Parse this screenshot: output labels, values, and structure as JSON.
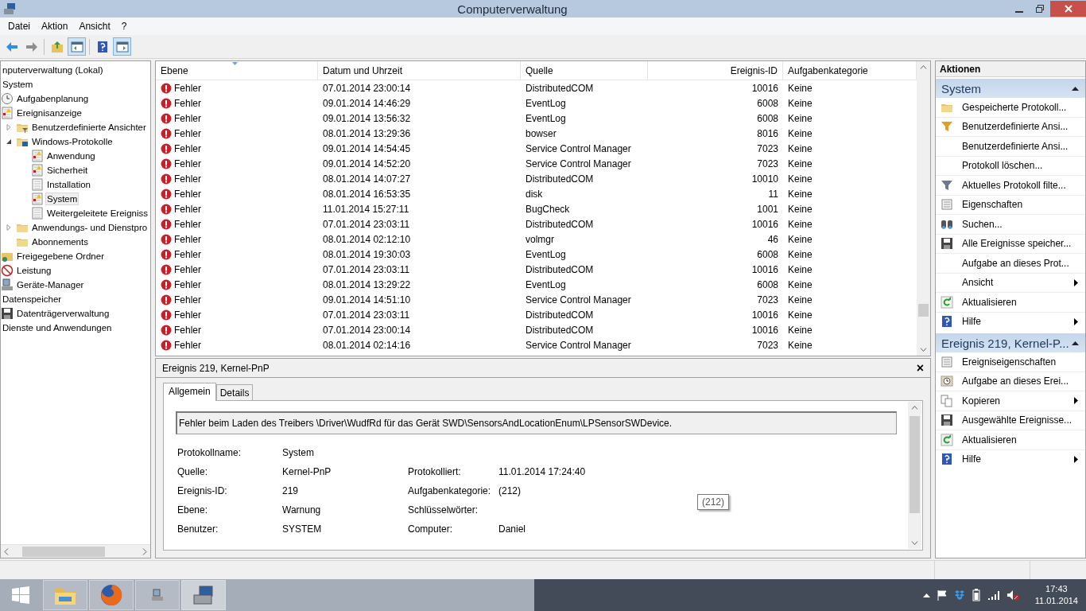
{
  "window": {
    "title": "Computerverwaltung"
  },
  "menu": [
    "Datei",
    "Aktion",
    "Ansicht",
    "?"
  ],
  "toolbar": [
    {
      "kind": "back",
      "pressed": false
    },
    {
      "kind": "forward",
      "pressed": false
    },
    {
      "kind": "sep"
    },
    {
      "kind": "up",
      "pressed": false
    },
    {
      "kind": "tree",
      "pressed": true
    },
    {
      "kind": "sep"
    },
    {
      "kind": "help",
      "pressed": false
    },
    {
      "kind": "pane",
      "pressed": true
    }
  ],
  "tree": [
    {
      "label": "nputerverwaltung (Lokal)",
      "selected": false,
      "children": [
        {
          "label": "System",
          "selected": false,
          "children": [
            {
              "label": "Aufgabenplanung",
              "kind": "clock",
              "selected": false
            },
            {
              "label": "Ereignisanzeige",
              "kind": "viewer",
              "selected": false,
              "children": [
                {
                  "label": "Benutzerdefinierte Ansichter",
                  "kind": "filterfolder",
                  "expanded": false,
                  "selected": false
                },
                {
                  "label": "Windows-Protokolle",
                  "kind": "pcfolder",
                  "expanded": true,
                  "selected": false,
                  "children": [
                    {
                      "label": "Anwendung",
                      "kind": "log",
                      "selected": false
                    },
                    {
                      "label": "Sicherheit",
                      "kind": "log",
                      "selected": false
                    },
                    {
                      "label": "Installation",
                      "kind": "plainlog",
                      "selected": false
                    },
                    {
                      "label": "System",
                      "kind": "log",
                      "selected": true
                    },
                    {
                      "label": "Weitergeleitete Ereigniss",
                      "kind": "plainlog",
                      "selected": false
                    }
                  ]
                },
                {
                  "label": "Anwendungs- und Dienstpro",
                  "kind": "folder",
                  "expanded": false,
                  "selected": false
                },
                {
                  "label": "Abonnements",
                  "kind": "folder",
                  "selected": false
                }
              ]
            },
            {
              "label": "Freigegebene Ordner",
              "kind": "share",
              "selected": false
            },
            {
              "label": "Leistung",
              "kind": "perf",
              "selected": false
            },
            {
              "label": "Geräte-Manager",
              "kind": "device",
              "selected": false
            }
          ]
        },
        {
          "label": "Datenspeicher",
          "selected": false,
          "children": [
            {
              "label": "Datenträgerverwaltung",
              "kind": "disk",
              "selected": false
            }
          ]
        },
        {
          "label": "Dienste und Anwendungen",
          "selected": false
        }
      ]
    }
  ],
  "table": {
    "columns": [
      {
        "label": "Ebene",
        "sorted": true
      },
      {
        "label": "Datum und Uhrzeit",
        "sorted": false
      },
      {
        "label": "Quelle",
        "sorted": false
      },
      {
        "label": "Ereignis-ID",
        "sorted": false
      },
      {
        "label": "Aufgabenkategorie",
        "sorted": false
      }
    ],
    "rows": [
      {
        "kind": "error",
        "level": "Fehler",
        "date": "07.01.2014 23:00:14",
        "source": "DistributedCOM",
        "id": "10016",
        "category": "Keine"
      },
      {
        "kind": "error",
        "level": "Fehler",
        "date": "09.01.2014 14:46:29",
        "source": "EventLog",
        "id": "6008",
        "category": "Keine"
      },
      {
        "kind": "error",
        "level": "Fehler",
        "date": "09.01.2014 13:56:32",
        "source": "EventLog",
        "id": "6008",
        "category": "Keine"
      },
      {
        "kind": "error",
        "level": "Fehler",
        "date": "08.01.2014 13:29:36",
        "source": "bowser",
        "id": "8016",
        "category": "Keine"
      },
      {
        "kind": "error",
        "level": "Fehler",
        "date": "09.01.2014 14:54:45",
        "source": "Service Control Manager",
        "id": "7023",
        "category": "Keine"
      },
      {
        "kind": "error",
        "level": "Fehler",
        "date": "09.01.2014 14:52:20",
        "source": "Service Control Manager",
        "id": "7023",
        "category": "Keine"
      },
      {
        "kind": "error",
        "level": "Fehler",
        "date": "08.01.2014 14:07:27",
        "source": "DistributedCOM",
        "id": "10010",
        "category": "Keine"
      },
      {
        "kind": "error",
        "level": "Fehler",
        "date": "08.01.2014 16:53:35",
        "source": "disk",
        "id": "11",
        "category": "Keine"
      },
      {
        "kind": "error",
        "level": "Fehler",
        "date": "11.01.2014 15:27:11",
        "source": "BugCheck",
        "id": "1001",
        "category": "Keine"
      },
      {
        "kind": "error",
        "level": "Fehler",
        "date": "07.01.2014 23:03:11",
        "source": "DistributedCOM",
        "id": "10016",
        "category": "Keine"
      },
      {
        "kind": "error",
        "level": "Fehler",
        "date": "08.01.2014 02:12:10",
        "source": "volmgr",
        "id": "46",
        "category": "Keine"
      },
      {
        "kind": "error",
        "level": "Fehler",
        "date": "08.01.2014 19:30:03",
        "source": "EventLog",
        "id": "6008",
        "category": "Keine"
      },
      {
        "kind": "error",
        "level": "Fehler",
        "date": "07.01.2014 23:03:11",
        "source": "DistributedCOM",
        "id": "10016",
        "category": "Keine"
      },
      {
        "kind": "error",
        "level": "Fehler",
        "date": "08.01.2014 13:29:22",
        "source": "EventLog",
        "id": "6008",
        "category": "Keine"
      },
      {
        "kind": "error",
        "level": "Fehler",
        "date": "09.01.2014 14:51:10",
        "source": "Service Control Manager",
        "id": "7023",
        "category": "Keine"
      },
      {
        "kind": "error",
        "level": "Fehler",
        "date": "07.01.2014 23:03:11",
        "source": "DistributedCOM",
        "id": "10016",
        "category": "Keine"
      },
      {
        "kind": "error",
        "level": "Fehler",
        "date": "07.01.2014 23:00:14",
        "source": "DistributedCOM",
        "id": "10016",
        "category": "Keine"
      },
      {
        "kind": "error",
        "level": "Fehler",
        "date": "08.01.2014 02:14:16",
        "source": "Service Control Manager",
        "id": "7023",
        "category": "Keine"
      }
    ]
  },
  "detail": {
    "title": "Ereignis 219, Kernel-PnP",
    "close": "×",
    "tabs": [
      {
        "label": "Allgemein",
        "selected": true
      },
      {
        "label": "Details",
        "selected": false
      }
    ],
    "message": "Fehler beim Laden des Treibers \\Driver\\WudfRd für das Gerät SWD\\SensorsAndLocationEnum\\LPSensorSWDevice.",
    "fields_left": [
      {
        "label": "Protokollname:",
        "value": "System"
      },
      {
        "label": "Quelle:",
        "value": "Kernel-PnP"
      },
      {
        "label": "Ereignis-ID:",
        "value": "219"
      },
      {
        "label": "Ebene:",
        "value": "Warnung"
      },
      {
        "label": "Benutzer:",
        "value": "SYSTEM"
      }
    ],
    "fields_right": [
      {
        "label": "Protokolliert:",
        "value": "11.01.2014 17:24:40"
      },
      {
        "label": "Aufgabenkategorie:",
        "value": "(212)"
      },
      {
        "label": "Schlüsselwörter:"
      },
      {
        "label": "Computer:",
        "value": "Daniel"
      }
    ],
    "tooltip": "(212)"
  },
  "actions": {
    "title": "Aktionen",
    "sections": [
      {
        "title": "System",
        "expanded": true,
        "items": [
          {
            "label": "Gespeicherte Protokoll...",
            "kind": "openfolder"
          },
          {
            "label": "Benutzerdefinierte Ansi...",
            "kind": "filterstar"
          },
          {
            "label": "Benutzerdefinierte Ansi..."
          },
          {
            "label": "Protokoll löschen..."
          },
          {
            "label": "Aktuelles Protokoll filte...",
            "kind": "filter"
          },
          {
            "label": "Eigenschaften",
            "kind": "props"
          },
          {
            "label": "Suchen...",
            "kind": "binoculars"
          },
          {
            "label": "Alle Ereignisse speicher...",
            "kind": "save"
          },
          {
            "label": "Aufgabe an dieses Prot..."
          },
          {
            "label": "Ansicht",
            "submenu": true
          },
          {
            "label": "Aktualisieren",
            "kind": "refresh"
          },
          {
            "label": "Hilfe",
            "kind": "help",
            "submenu": true
          }
        ]
      },
      {
        "title": "Ereignis 219, Kernel-P...",
        "expanded": true,
        "items": [
          {
            "label": "Ereigniseigenschaften",
            "kind": "props"
          },
          {
            "label": "Aufgabe an dieses Erei...",
            "kind": "task"
          },
          {
            "label": "Kopieren",
            "kind": "copy",
            "submenu": true
          },
          {
            "label": "Ausgewählte Ereignisse...",
            "kind": "save"
          },
          {
            "label": "Aktualisieren",
            "kind": "refresh"
          },
          {
            "label": "Hilfe",
            "kind": "help",
            "submenu": true
          }
        ]
      }
    ]
  },
  "taskbar": {
    "apps": [
      {
        "kind": "explorer",
        "selected": false
      },
      {
        "kind": "firefox",
        "selected": false
      },
      {
        "kind": "server",
        "selected": false
      },
      {
        "kind": "compmgmt",
        "selected": true
      }
    ],
    "time": "17:43",
    "date": "11.01.2014"
  }
}
